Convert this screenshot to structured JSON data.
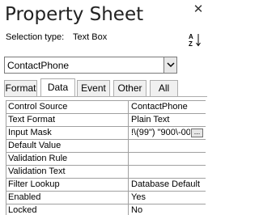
{
  "header": {
    "title": "Property Sheet",
    "close_glyph": "✕"
  },
  "selection": {
    "label": "Selection type:",
    "value": "Text Box"
  },
  "icons": {
    "sort": "sort-az-icon",
    "dropdown": "chevron-down-icon",
    "builder": "ellipsis-icon"
  },
  "object_combo": {
    "value": "ContactPhone"
  },
  "tabs": [
    {
      "label": "Format",
      "active": false
    },
    {
      "label": "Data",
      "active": true
    },
    {
      "label": "Event",
      "active": false
    },
    {
      "label": "Other",
      "active": false
    },
    {
      "label": "All",
      "active": false
    }
  ],
  "properties": [
    {
      "name": "Control Source",
      "value": "ContactPhone"
    },
    {
      "name": "Text Format",
      "value": "Plain Text"
    },
    {
      "name": "Input Mask",
      "value": "!\\(99\") \"900\\-00"
    },
    {
      "name": "Default Value",
      "value": ""
    },
    {
      "name": "Validation Rule",
      "value": ""
    },
    {
      "name": "Validation Text",
      "value": ""
    },
    {
      "name": "Filter Lookup",
      "value": "Database Default"
    },
    {
      "name": "Enabled",
      "value": "Yes"
    },
    {
      "name": "Locked",
      "value": "No"
    }
  ],
  "builder_button": {
    "label": "..."
  }
}
